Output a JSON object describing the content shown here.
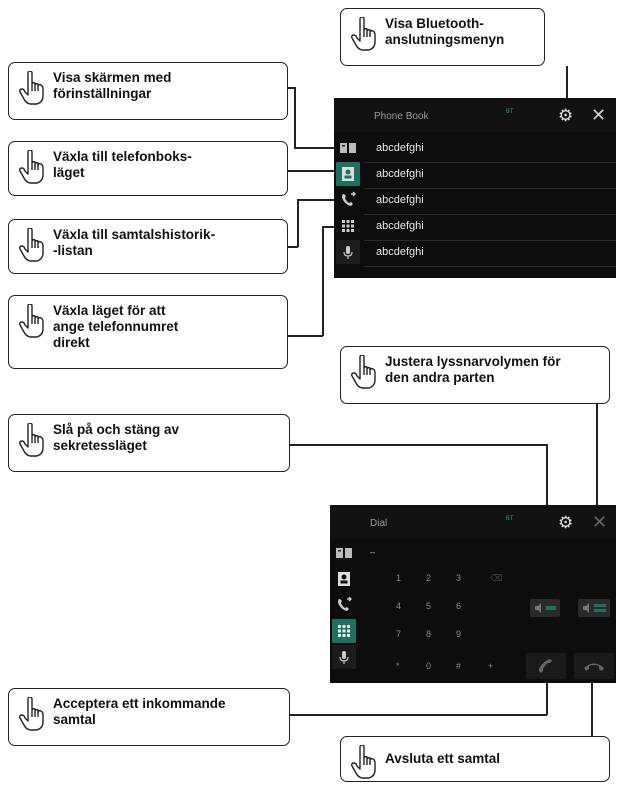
{
  "callouts": {
    "bluetooth_menu": "Visa Bluetooth-\nanslutningsmenyn",
    "presets": "Visa skärmen med\nförinställningar",
    "phonebook_mode": "Växla till telefonboks-\nläget",
    "call_history": "Växla till samtalshistorik-\n-listan",
    "direct_dial": "Växla läget för att\nange telefonnumret\ndirekt",
    "listener_volume": "Justera lyssnarvolymen för\nden andra parten",
    "privacy_mode": "Slå på och stäng av\nsekretessläget",
    "accept_call": "Acceptera ett inkommande\nsamtal",
    "end_call": "Avsluta ett samtal"
  },
  "screen1": {
    "title": "Phone Book",
    "bt_indicator": "BT",
    "contacts": [
      "abcdefghi",
      "abcdefghi",
      "abcdefghi",
      "abcdefghi",
      "abcdefghi"
    ]
  },
  "screen2": {
    "title": "Dial",
    "bt_indicator": "BT",
    "number_display": "–",
    "keypad": [
      "1",
      "2",
      "3",
      "4",
      "5",
      "6",
      "7",
      "8",
      "9",
      "*",
      "0",
      "#",
      "+"
    ]
  },
  "icons": {
    "touch": "pointing-hand-icon",
    "gear": "gear-icon",
    "close": "close-icon"
  },
  "colors": {
    "accent": "#1f7060",
    "screen_bg": "#0d0d0d",
    "text_light": "#e8e8e8"
  }
}
